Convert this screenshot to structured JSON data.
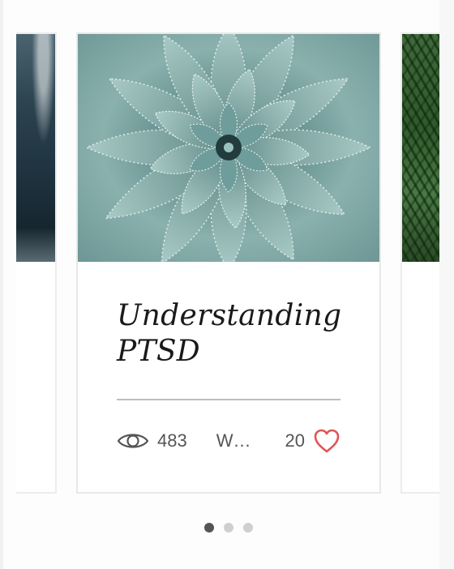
{
  "carousel": {
    "cards": [
      {
        "image": "ocean-wave-photo"
      },
      {
        "image": "agave-succulent-photo",
        "title": "Understanding PTSD",
        "views": "483",
        "author": "W…",
        "likes": "20"
      },
      {
        "image": "fern-leaves-photo"
      }
    ],
    "pagination": {
      "count": 3,
      "active_index": 0
    }
  },
  "icons": {
    "views": "eye-icon",
    "likes": "heart-outline-icon"
  },
  "colors": {
    "heart": "#e05553",
    "text": "#555555",
    "title": "#1a1a1a",
    "dot_active": "#555555",
    "dot_inactive": "#cfcfcf",
    "agave_base": "#7fa8a6"
  }
}
